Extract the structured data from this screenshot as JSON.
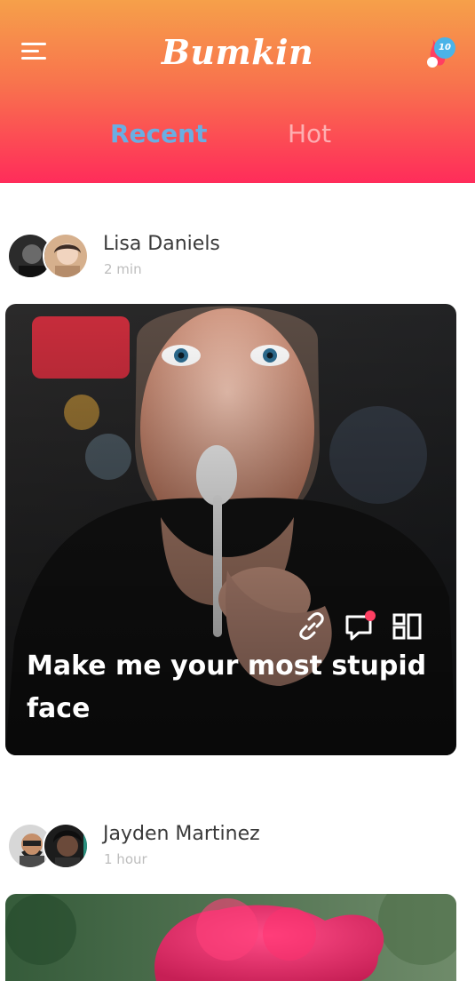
{
  "header": {
    "brand": "Bumkin",
    "notification_count": "10",
    "icons": {
      "menu": "hamburger-icon",
      "notifications": "flame-bell-icon"
    },
    "colors": {
      "gradient_top": "#f6a04a",
      "gradient_bottom": "#ff2c5a",
      "badge": "#4ab3e8"
    }
  },
  "tabs": [
    {
      "label": "Recent",
      "active": true,
      "color": "#6aaee2"
    },
    {
      "label": "Hot",
      "active": false
    }
  ],
  "feed": {
    "posts": [
      {
        "author": "Lisa Daniels",
        "time": "2 min",
        "caption": "Make me your most stupid face",
        "actions": [
          "link-icon",
          "comment-icon",
          "layout-icon"
        ],
        "comment_notification_dot": true
      },
      {
        "author": "Jayden Martinez",
        "time": "1 hour",
        "caption": ""
      }
    ]
  }
}
